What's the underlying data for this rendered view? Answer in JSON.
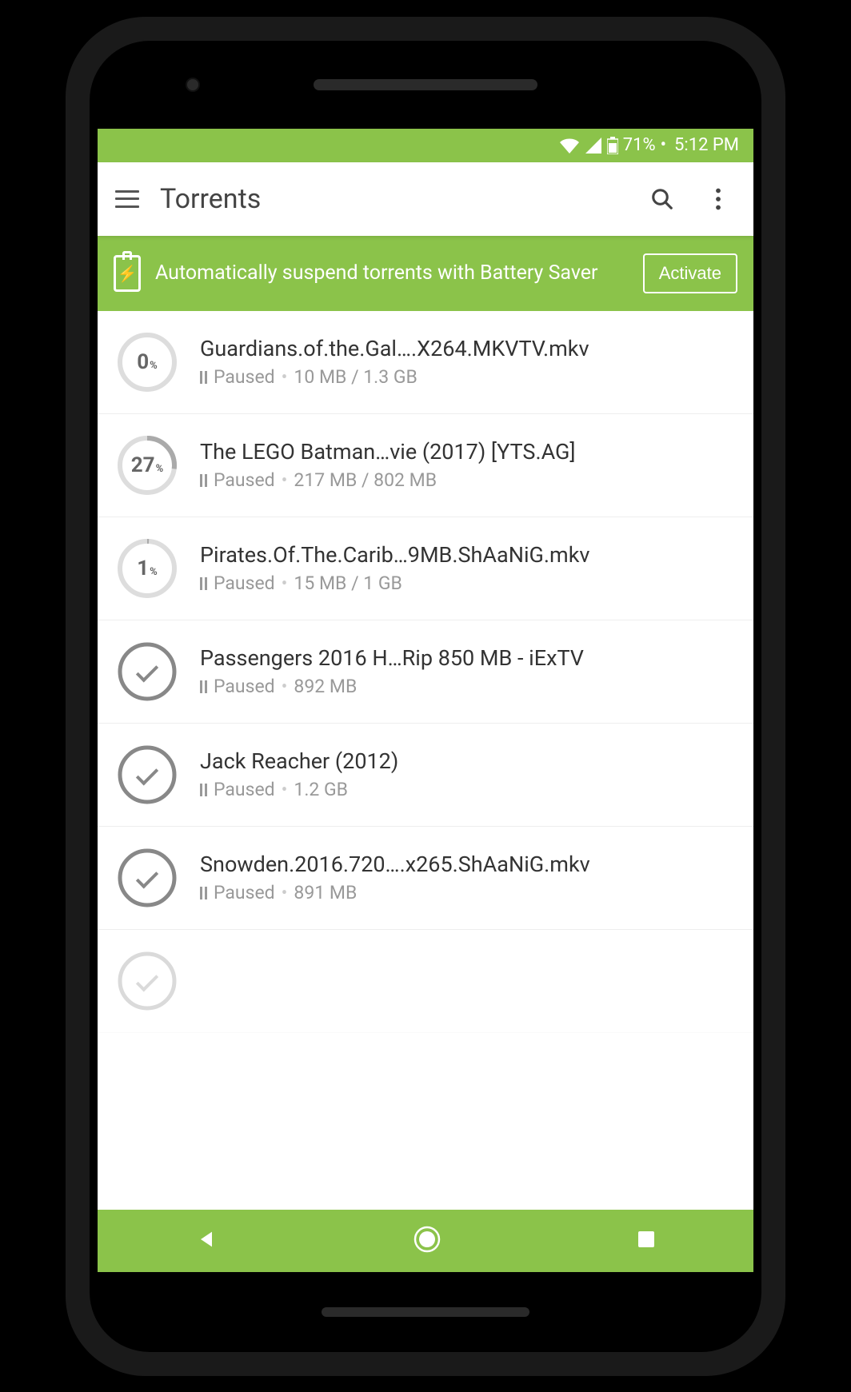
{
  "status": {
    "battery": "71%",
    "time": "5:12 PM"
  },
  "app": {
    "title": "Torrents"
  },
  "banner": {
    "text": "Automatically suspend torrents with Battery Saver",
    "button": "Activate"
  },
  "torrents": [
    {
      "percent": "0",
      "complete": false,
      "title": "Guardians.of.the.Gal….X264.MKVTV.mkv",
      "status": "Paused",
      "size": "10 MB / 1.3 GB"
    },
    {
      "percent": "27",
      "complete": false,
      "title": "The LEGO Batman…vie (2017) [YTS.AG]",
      "status": "Paused",
      "size": "217 MB / 802 MB"
    },
    {
      "percent": "1",
      "complete": false,
      "title": "Pirates.Of.The.Carib…9MB.ShAaNiG.mkv",
      "status": "Paused",
      "size": "15 MB / 1 GB"
    },
    {
      "percent": "100",
      "complete": true,
      "title": "Passengers 2016 H…Rip 850 MB - iExTV",
      "status": "Paused",
      "size": "892 MB"
    },
    {
      "percent": "100",
      "complete": true,
      "title": "Jack Reacher (2012)",
      "status": "Paused",
      "size": "1.2 GB"
    },
    {
      "percent": "100",
      "complete": true,
      "title": "Snowden.2016.720….x265.ShAaNiG.mkv",
      "status": "Paused",
      "size": "891 MB"
    }
  ]
}
